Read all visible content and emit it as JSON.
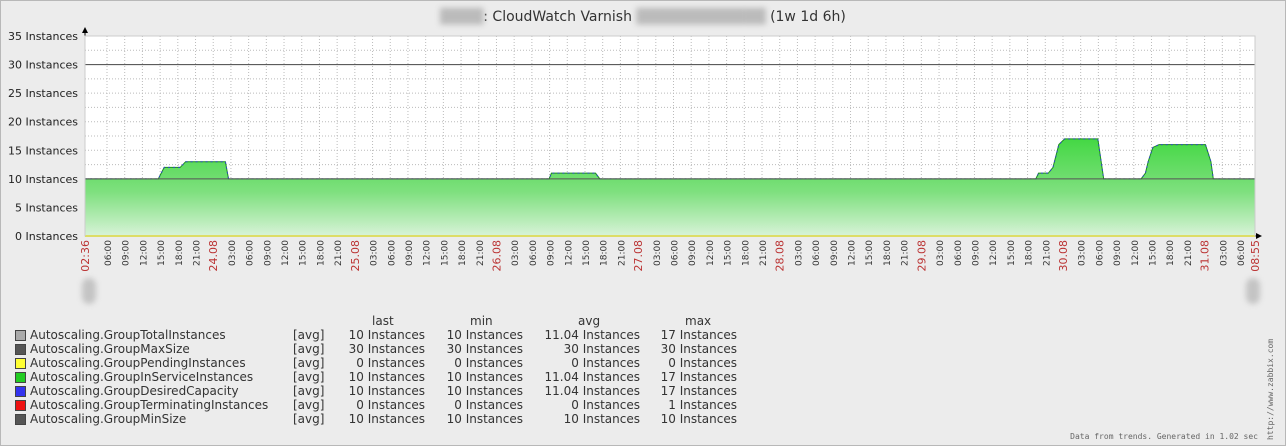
{
  "title": {
    "blurred_prefix": "████",
    "main": ": CloudWatch Varnish",
    "blurred_mid": "████████████",
    "period": "(1w 1d 6h)"
  },
  "chart_data": {
    "type": "area",
    "y_unit": "Instances",
    "ylim": [
      0,
      35
    ],
    "y_ticks": [
      "0 Instances",
      "5 Instances",
      "10 Instances",
      "15 Instances",
      "20 Instances",
      "25 Instances",
      "30 Instances",
      "35 Instances"
    ],
    "x_start_label": "02:36",
    "x_end_label": "08:55",
    "x_tick_labels": [
      "06:00",
      "09:00",
      "12:00",
      "15:00",
      "18:00",
      "21:00",
      "24.08",
      "03:00",
      "06:00",
      "09:00",
      "12:00",
      "15:00",
      "18:00",
      "21:00",
      "25.08",
      "03:00",
      "06:00",
      "09:00",
      "12:00",
      "15:00",
      "18:00",
      "21:00",
      "26.08",
      "03:00",
      "06:00",
      "09:00",
      "12:00",
      "15:00",
      "18:00",
      "21:00",
      "27.08",
      "03:00",
      "06:00",
      "09:00",
      "12:00",
      "15:00",
      "18:00",
      "21:00",
      "28.08",
      "03:00",
      "06:00",
      "09:00",
      "12:00",
      "15:00",
      "18:00",
      "21:00",
      "29.08",
      "03:00",
      "06:00",
      "09:00",
      "12:00",
      "15:00",
      "18:00",
      "21:00",
      "30.08",
      "03:00",
      "06:00",
      "09:00",
      "12:00",
      "15:00",
      "18:00",
      "21:00",
      "31.08",
      "03:00",
      "06:00"
    ],
    "date_labels": [
      "24.08",
      "25.08",
      "26.08",
      "27.08",
      "28.08",
      "29.08",
      "30.08",
      "31.08"
    ],
    "x_hours_total": 198.32,
    "series": [
      {
        "name": "Autoscaling.GroupInServiceInstances",
        "color": "#22cc22",
        "style": "filled",
        "points": [
          [
            0,
            10
          ],
          [
            18.8,
            10
          ],
          [
            20.3,
            12
          ],
          [
            24.4,
            12
          ],
          [
            25.8,
            13
          ],
          [
            36.0,
            13
          ],
          [
            36.8,
            10
          ],
          [
            119.0,
            10
          ],
          [
            119.6,
            11
          ],
          [
            130.9,
            11
          ],
          [
            132.0,
            10
          ],
          [
            240.0,
            10
          ],
          [
            243.8,
            10
          ],
          [
            244.5,
            11
          ],
          [
            247.0,
            11
          ],
          [
            248.2,
            12
          ],
          [
            249.7,
            16
          ],
          [
            251.2,
            17
          ],
          [
            259.7,
            17
          ],
          [
            261.2,
            10
          ],
          [
            270.0,
            10
          ],
          [
            270.8,
            10
          ],
          [
            271.9,
            11
          ],
          [
            272.6,
            13
          ],
          [
            273.8,
            15.5
          ],
          [
            275.4,
            16
          ],
          [
            287.3,
            16
          ],
          [
            288.7,
            13
          ],
          [
            289.3,
            10
          ],
          [
            300.0,
            10
          ]
        ]
      },
      {
        "name": "Autoscaling.GroupMaxSize",
        "color": "#444444",
        "style": "line",
        "constant": 30
      },
      {
        "name": "Autoscaling.GroupMinSize",
        "color": "#555555",
        "style": "line",
        "constant": 10
      },
      {
        "name": "Autoscaling.GroupTerminatingInstances",
        "color": "#ee1111",
        "style": "line",
        "constant": 0
      },
      {
        "name": "Autoscaling.GroupPendingInstances",
        "color": "#eeee00",
        "style": "line",
        "constant": 0
      }
    ],
    "grid": true,
    "legend_placement": "bottom"
  },
  "legend": {
    "headers": {
      "last": "last",
      "min": "min",
      "avg": "avg",
      "max": "max"
    },
    "rows": [
      {
        "name": "Autoscaling.GroupTotalInstances",
        "color": "#aaaaaa",
        "func": "[avg]",
        "last": "10 Instances",
        "min": "10 Instances",
        "avg": "11.04 Instances",
        "max": "17 Instances"
      },
      {
        "name": "Autoscaling.GroupMaxSize",
        "color": "#555555",
        "func": "[avg]",
        "last": "30 Instances",
        "min": "30 Instances",
        "avg": "30 Instances",
        "max": "30 Instances"
      },
      {
        "name": "Autoscaling.GroupPendingInstances",
        "color": "#ffff33",
        "func": "[avg]",
        "last": "0 Instances",
        "min": "0 Instances",
        "avg": "0 Instances",
        "max": "0 Instances"
      },
      {
        "name": "Autoscaling.GroupInServiceInstances",
        "color": "#22cc22",
        "func": "[avg]",
        "last": "10 Instances",
        "min": "10 Instances",
        "avg": "11.04 Instances",
        "max": "17 Instances"
      },
      {
        "name": "Autoscaling.GroupDesiredCapacity",
        "color": "#3333ee",
        "func": "[avg]",
        "last": "10 Instances",
        "min": "10 Instances",
        "avg": "11.04 Instances",
        "max": "17 Instances"
      },
      {
        "name": "Autoscaling.GroupTerminatingInstances",
        "color": "#ee1111",
        "func": "[avg]",
        "last": "0 Instances",
        "min": "0 Instances",
        "avg": "0 Instances",
        "max": "1 Instances"
      },
      {
        "name": "Autoscaling.GroupMinSize",
        "color": "#555555",
        "func": "[avg]",
        "last": "10 Instances",
        "min": "10 Instances",
        "avg": "10 Instances",
        "max": "10 Instances"
      }
    ]
  },
  "footer": "Data from trends. Generated in 1.02 sec",
  "side_url": "http://www.zabbix.com"
}
